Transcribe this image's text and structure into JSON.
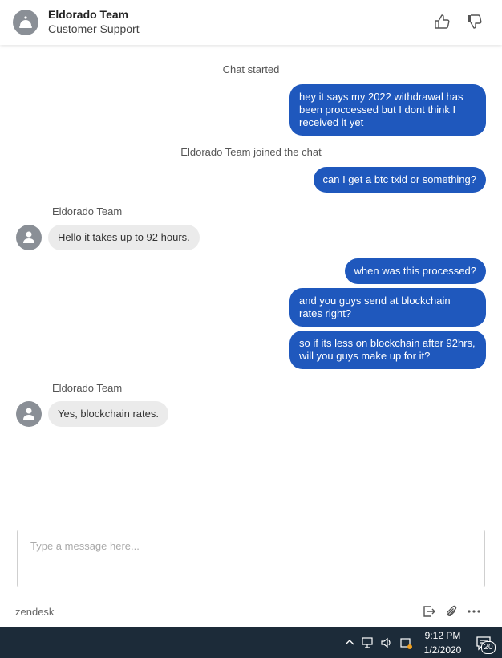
{
  "header": {
    "agent_name": "Eldorado Team",
    "agent_subtitle": "Customer Support"
  },
  "chat": {
    "system_started": "Chat started",
    "system_joined": "Eldorado Team joined the chat",
    "messages": [
      {
        "from": "visitor",
        "text": "hey it  says my 2022 withdrawal has been proccessed but I dont think I received it yet"
      },
      {
        "from": "visitor",
        "text": "can I get a btc txid or something?"
      },
      {
        "from": "agent",
        "label": "Eldorado Team",
        "text": "Hello it takes up to 92 hours."
      },
      {
        "from": "visitor",
        "text": "when was this processed?"
      },
      {
        "from": "visitor",
        "text": "and you guys send at blockchain rates right?"
      },
      {
        "from": "visitor",
        "text": "so if its less  on blockchain after 92hrs, will you guys make up for it?"
      },
      {
        "from": "agent",
        "label": "Eldorado Team",
        "text": "Yes, blockchain rates."
      }
    ]
  },
  "composer": {
    "placeholder": "Type a message here...",
    "value": ""
  },
  "footer": {
    "brand": "zendesk"
  },
  "taskbar": {
    "time": "9:12 PM",
    "date": "1/2/2020",
    "notification_count": "20"
  },
  "colors": {
    "visitor_bubble": "#1f58bd",
    "agent_bubble": "#ebebeb",
    "taskbar": "#1c2b39"
  }
}
